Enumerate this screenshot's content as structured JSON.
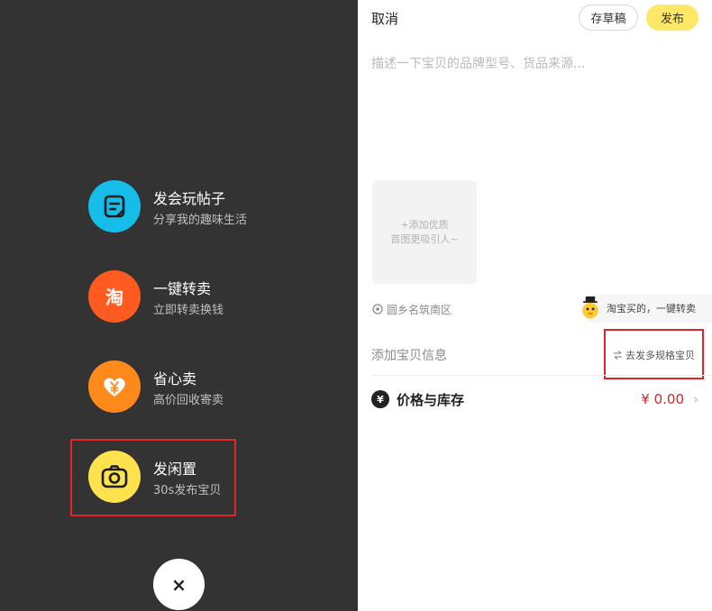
{
  "menu": {
    "items": [
      {
        "title": "发会玩帖子",
        "subtitle": "分享我的趣味生活",
        "icon": "note-icon",
        "color": "#15bde8"
      },
      {
        "title": "一键转卖",
        "subtitle": "立即转卖换钱",
        "icon": "taobao-icon",
        "color": "#ff5a1f"
      },
      {
        "title": "省心卖",
        "subtitle": "高价回收寄卖",
        "icon": "heart-yen-icon",
        "color": "#ff8a1c"
      },
      {
        "title": "发闲置",
        "subtitle": "30s发布宝贝",
        "icon": "camera-icon",
        "color": "#ffe24d"
      }
    ],
    "close_symbol": "×"
  },
  "publish": {
    "cancel": "取消",
    "draft": "存草稿",
    "publish": "发布",
    "description_placeholder": "描述一下宝贝的品牌型号、货品来源...",
    "add_photo_line1": "+添加优质",
    "add_photo_line2": "首图更吸引人~",
    "location": "圆乡名筑南区",
    "promo_text": "淘宝买的，一键转卖",
    "info_label": "添加宝贝信息",
    "multi_spec": "去发多规格宝贝",
    "price_label": "价格与库存",
    "price_value": "¥ 0.00",
    "yen_symbol": "¥"
  },
  "colors": {
    "accent": "#ffe866",
    "price": "#e02020",
    "highlight": "#e0242a"
  }
}
